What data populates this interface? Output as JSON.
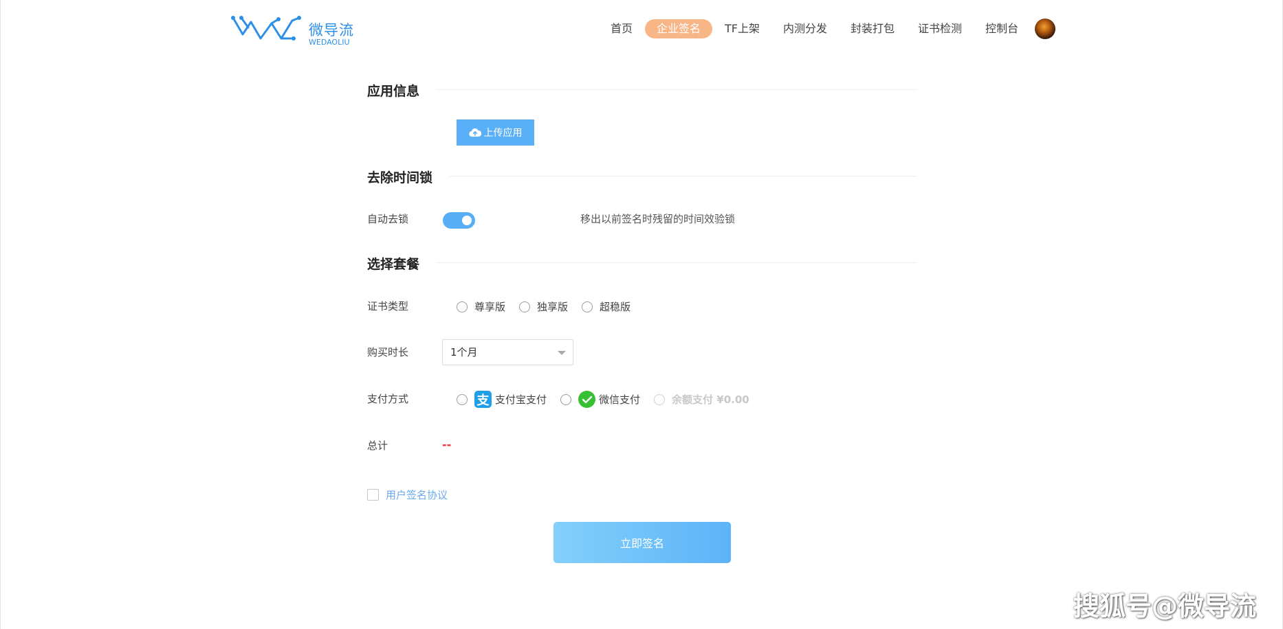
{
  "brand": {
    "name_cn": "微导流",
    "name_en": "WEDAOLIU",
    "color": "#2e8fe6"
  },
  "nav": {
    "items": [
      {
        "label": "首页"
      },
      {
        "label": "企业签名",
        "active": true
      },
      {
        "label": "TF上架"
      },
      {
        "label": "内测分发"
      },
      {
        "label": "封装打包"
      },
      {
        "label": "证书检测"
      },
      {
        "label": "控制台"
      }
    ],
    "active_color": "#f8b687",
    "avatar_icon": "user-avatar-icon"
  },
  "app_info": {
    "title": "应用信息",
    "upload_button": "上传应用",
    "upload_icon": "cloud-upload-icon"
  },
  "time_lock": {
    "title": "去除时间锁",
    "auto_label": "自动去锁",
    "enabled": true,
    "hint": "移出以前签名时残留的时间效验锁"
  },
  "package": {
    "title": "选择套餐",
    "cert_label": "证书类型",
    "cert_options": [
      "尊享版",
      "独享版",
      "超稳版"
    ],
    "duration_label": "购买时长",
    "duration_value": "1个月",
    "payment_label": "支付方式",
    "payment_options": [
      {
        "label": "支付宝支付",
        "icon": "alipay-icon"
      },
      {
        "label": "微信支付",
        "icon": "wechat-pay-icon"
      },
      {
        "label": "余额支付 ¥0.00",
        "disabled": true
      }
    ],
    "total_label": "总计",
    "total_value": "--"
  },
  "agreement": {
    "label": "用户签名协议",
    "checked": false
  },
  "submit": {
    "label": "立即签名"
  },
  "watermark": "搜狐号@微导流",
  "colors": {
    "primary": "#5ab0f6",
    "accent_red": "#ef2b2b",
    "link": "#6aaaf0"
  }
}
